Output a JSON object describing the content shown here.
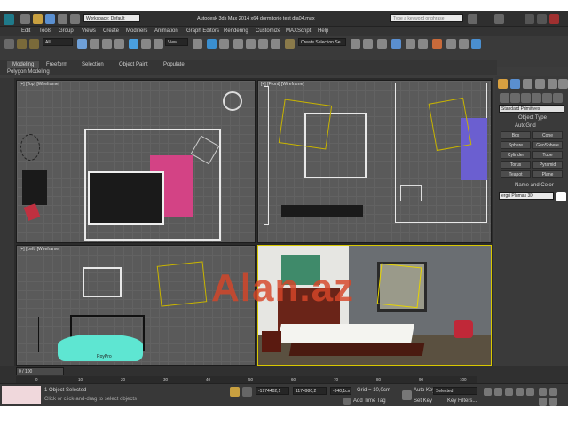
{
  "titlebar": {
    "workspace": "Workspace: Default",
    "title": "Autodesk 3ds Max 2014 x64    dormitorio test dia04.max",
    "search_placeholder": "Type a keyword or phrase"
  },
  "menu": [
    "Edit",
    "Tools",
    "Group",
    "Views",
    "Create",
    "Modifiers",
    "Animation",
    "Graph Editors",
    "Rendering",
    "Customize",
    "MAXScript",
    "Help"
  ],
  "toolbar": {
    "selection_filter": "All",
    "reference_coord": "View",
    "named_selection": "Create Selection Se"
  },
  "ribbon": {
    "tabs": [
      "Modeling",
      "Freeform",
      "Selection",
      "Object Paint",
      "Populate"
    ],
    "sub": "Polygon Modeling"
  },
  "viewports": {
    "top": "[+] [Top] [Wireframe]",
    "front": "[+] [Front] [Wireframe]",
    "left": "[+] [Left] [Wireframe]",
    "camera_label": "RoyPro"
  },
  "watermark": "Alan.az",
  "command_panel": {
    "dropdown": "Standard Primitives",
    "rollout": "Object Type",
    "autogrid": "AutoGrid",
    "buttons": [
      "Box",
      "Cone",
      "Sphere",
      "GeoSphere",
      "Cylinder",
      "Tube",
      "Torus",
      "Pyramid",
      "Teapot",
      "Plane"
    ],
    "name_rollout": "Name and Color",
    "name_value": "ergri Plumas 3D"
  },
  "timeline": {
    "frame": "0 / 100",
    "ticks": [
      "0",
      "10",
      "20",
      "30",
      "40",
      "50",
      "60",
      "70",
      "80",
      "90",
      "100"
    ]
  },
  "status": {
    "selected": "1 Object Selected",
    "hint": "Click or click-and-drag to select objects",
    "x": "-1974402,1",
    "y": "1174980,2",
    "z": "-340,1cm",
    "grid": "Grid = 10,0cm",
    "autokey": "Auto Key",
    "setkey": "Set Key",
    "selected_mode": "Selected",
    "keyfilters": "Key Filters...",
    "addtimetag": "Add Time Tag"
  },
  "colors": {
    "accent": "#d8c800",
    "pink": "#e0408a",
    "purple": "#6b5fd0",
    "cyan": "#5ee6d2"
  }
}
